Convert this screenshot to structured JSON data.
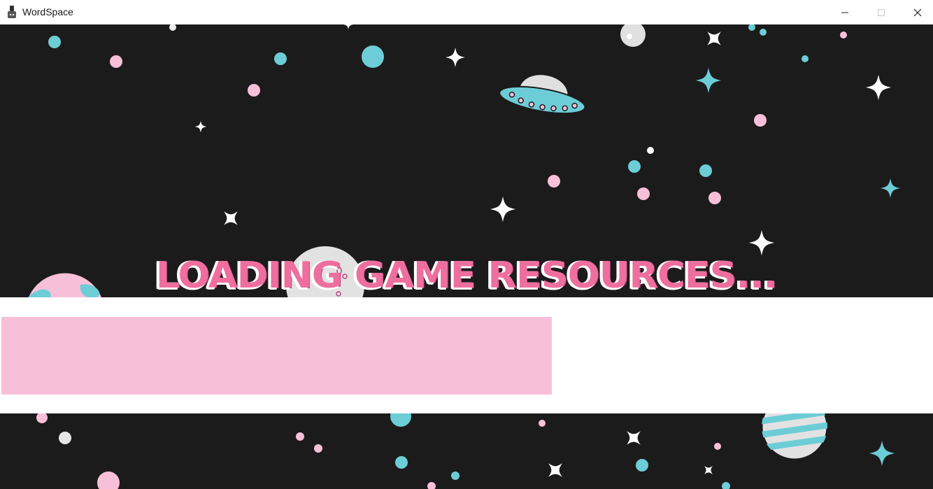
{
  "window": {
    "title": "WordSpace",
    "app_icon": "game-controller-icon",
    "controls": [
      "minimize-icon",
      "maximize-icon",
      "close-icon"
    ]
  },
  "loading": {
    "message": "LOADING GAME RESOURCES...",
    "progress": 0.59
  },
  "colors": {
    "background": "#1c1b1c",
    "accent_pink": "#ee6f9e",
    "progress_fill": "#f8c0d8",
    "progress_track": "#ffffff",
    "star_cyan": "#6ccdd6",
    "dot_pink": "#f8c0d8"
  }
}
